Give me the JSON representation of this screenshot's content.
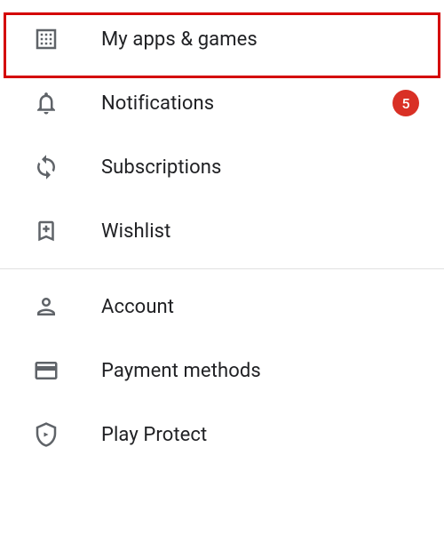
{
  "menu": {
    "items": [
      {
        "label": "My apps & games"
      },
      {
        "label": "Notifications",
        "badge": "5"
      },
      {
        "label": "Subscriptions"
      },
      {
        "label": "Wishlist"
      },
      {
        "label": "Account"
      },
      {
        "label": "Payment methods"
      },
      {
        "label": "Play Protect"
      }
    ]
  },
  "colors": {
    "icon": "#5f6368",
    "text": "#202124",
    "badge_bg": "#d93025",
    "highlight": "#d40000"
  }
}
